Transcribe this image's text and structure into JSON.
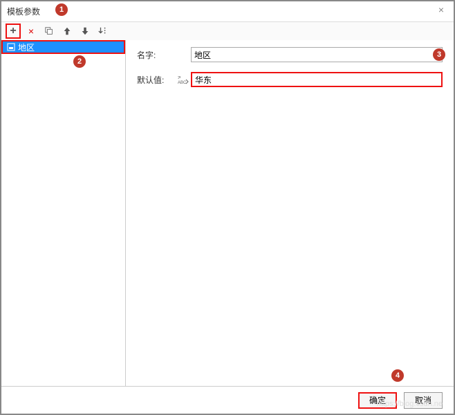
{
  "window": {
    "title": "模板参数"
  },
  "toolbar": {
    "add": "+",
    "delete": "×"
  },
  "sidebar": {
    "items": [
      {
        "label": "地区"
      }
    ]
  },
  "form": {
    "name_label": "名字:",
    "name_value": "地区",
    "default_label": "默认值:",
    "default_value": "华东"
  },
  "footer": {
    "ok": "确定",
    "cancel": "取消"
  },
  "badges": {
    "b1": "1",
    "b2": "2",
    "b3": "3",
    "b4": "4"
  },
  "watermark": "https://blog.csdn.ne"
}
